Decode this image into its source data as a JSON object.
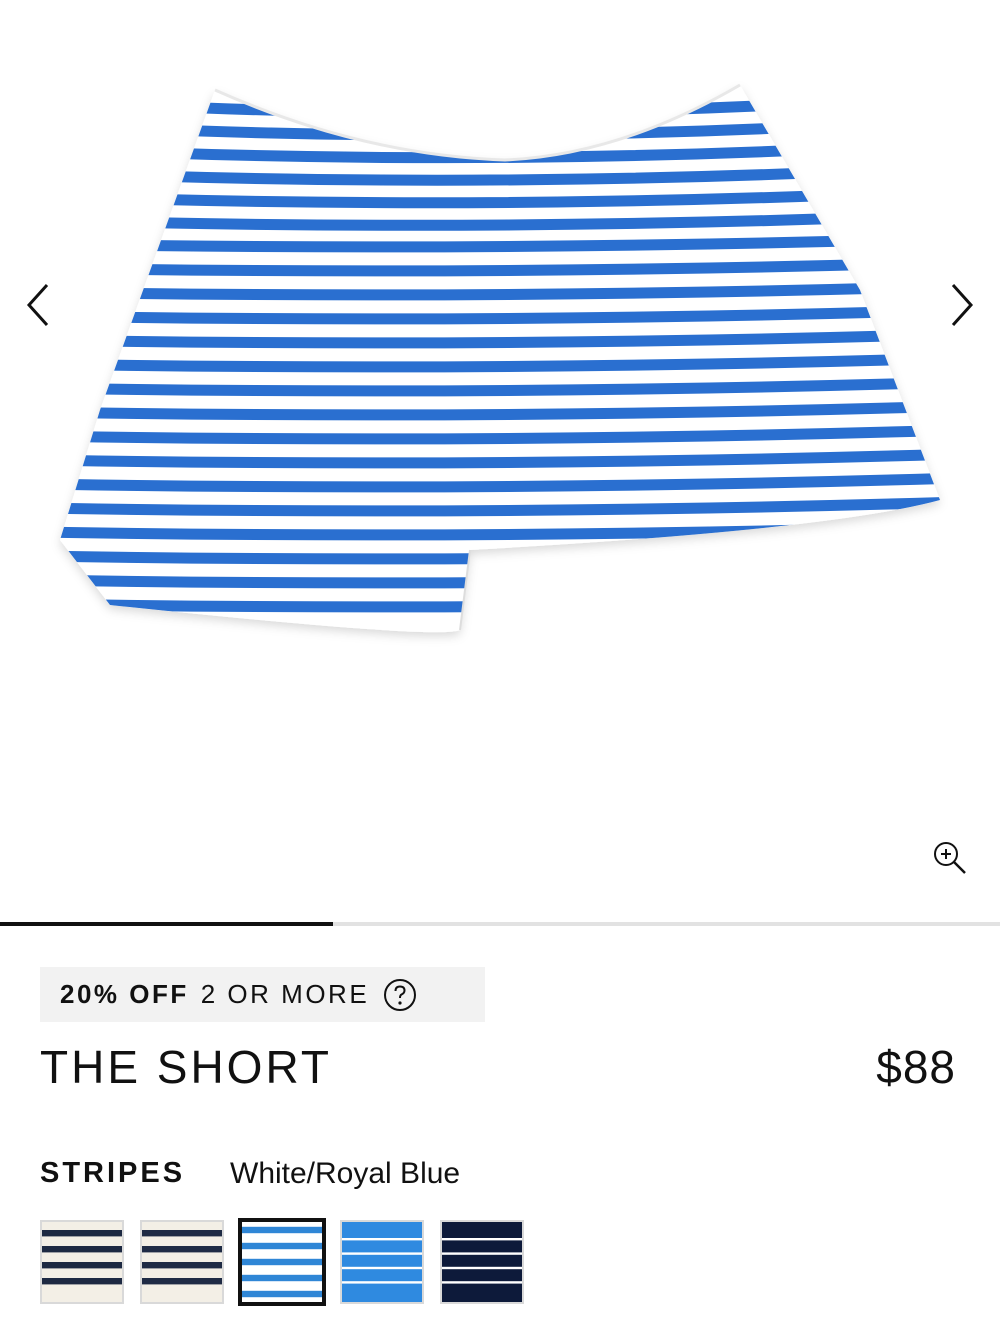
{
  "gallery": {
    "image_alt": "Blue and white striped shorts",
    "prev_icon": "chevron-left-icon",
    "next_icon": "chevron-right-icon",
    "zoom_icon": "zoom-in-icon",
    "progress_fraction": 0.333
  },
  "promo": {
    "strong": "20% OFF",
    "rest": "2 OR MORE",
    "help_icon": "question-circle-icon"
  },
  "product": {
    "title": "THE SHORT",
    "price": "$88"
  },
  "color": {
    "label": "STRIPES",
    "selected": "White/Royal Blue",
    "swatches": [
      {
        "name": "Cream/Navy",
        "bg": "#f3efe6",
        "stripe": "#1d2942"
      },
      {
        "name": "Navy/Cream",
        "bg": "#f3efe6",
        "stripe": "#1f2b45"
      },
      {
        "name": "White/Royal Blue",
        "bg": "#ffffff",
        "stripe": "#2f86d6"
      },
      {
        "name": "Royal Blue/White",
        "bg": "#2f8ae0",
        "stripe": "#ffffff"
      },
      {
        "name": "Navy/White",
        "bg": "#0d1a3a",
        "stripe": "#ffffff"
      }
    ]
  },
  "colors": {
    "stripe_blue": "#2a6fd0",
    "text": "#111111"
  }
}
